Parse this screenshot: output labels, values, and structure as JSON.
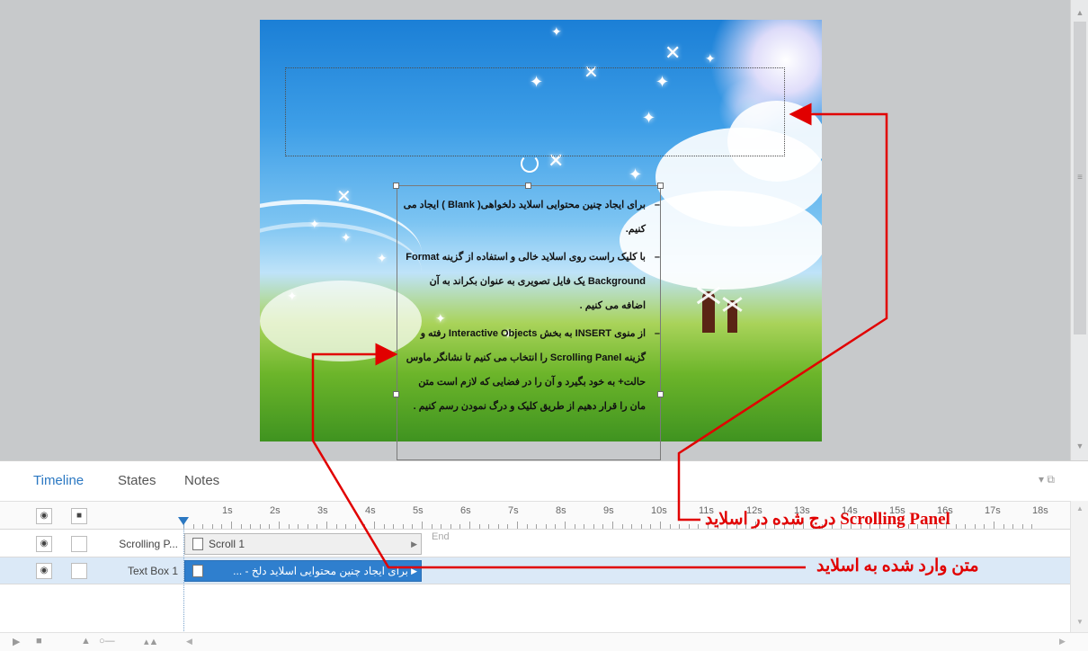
{
  "panel": {
    "tabs": [
      {
        "label": "Timeline",
        "active": true
      },
      {
        "label": "States",
        "active": false
      },
      {
        "label": "Notes",
        "active": false
      }
    ]
  },
  "slide": {
    "textbox": {
      "paragraphs": [
        "برای ایجاد چنین محتوایی اسلاید دلخواهی( Blank ) ایجاد می کنیم.",
        "با کلیک راست روی اسلاید خالی و استفاده از گزینه Format Background یک فایل تصویری به عنوان بکراند به آن اضافه می کنیم .",
        "از منوی INSERT به بخش Interactive Objects رفته و گزینه Scrolling Panel را انتخاب می کنیم تا نشانگر ماوس حالت+ به خود بگیرد و آن را در فضایی که لازم است متن مان را قرار دهیم از طریق کلیک و درگ نمودن رسم کنیم ."
      ]
    }
  },
  "timeline": {
    "ruler_labels": [
      "1s",
      "2s",
      "3s",
      "4s",
      "5s",
      "6s",
      "7s",
      "8s",
      "9s",
      "10s",
      "11s",
      "12s",
      "13s",
      "14s",
      "15s",
      "16s",
      "17s",
      "18s"
    ],
    "end_label": "End",
    "rows": [
      {
        "name": "Scrolling P...",
        "bar_label": "Scroll 1"
      },
      {
        "name": "Text Box 1",
        "bar_label": "برای ایجاد چنین محتوایی اسلاید دلخ - ..."
      }
    ]
  },
  "annotations": {
    "scrolling_panel_note": "Scrolling Panel  درج شده در اسلاید",
    "text_note": "متن وارد شده به اسلاید",
    "color": "#e10000"
  },
  "icons": {
    "visibility": "eye-icon",
    "lock": "lock-icon",
    "play": "play-icon",
    "stop": "stop-icon"
  }
}
